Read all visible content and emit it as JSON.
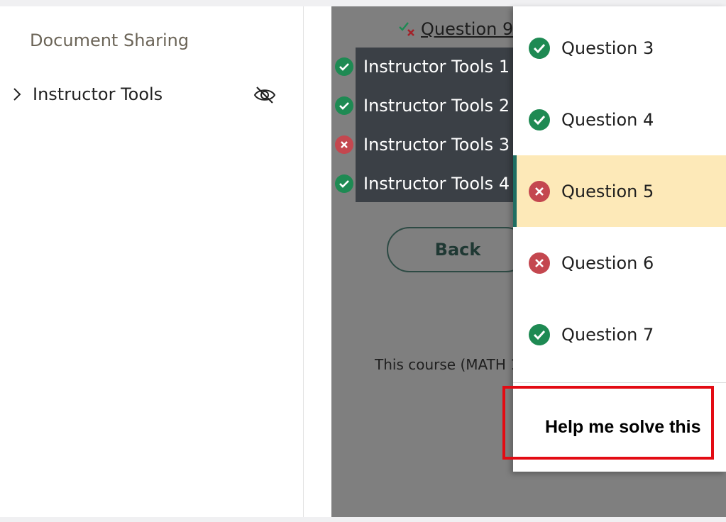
{
  "sidebar": {
    "heading": "Document Sharing",
    "items": [
      {
        "label": "Instructor Tools",
        "icon": "eye-slash-icon"
      }
    ]
  },
  "main": {
    "question_link": "Question 9",
    "tools": [
      {
        "label": "Instructor Tools 1",
        "status": "correct"
      },
      {
        "label": "Instructor Tools 2",
        "status": "correct"
      },
      {
        "label": "Instructor Tools 3",
        "status": "incorrect"
      },
      {
        "label": "Instructor Tools 4",
        "status": "correct"
      }
    ],
    "back_label": "Back",
    "course_text": "This course (MATH 1"
  },
  "question_panel": {
    "items": [
      {
        "label": "Question 3",
        "status": "correct",
        "active": false
      },
      {
        "label": "Question 4",
        "status": "correct",
        "active": false
      },
      {
        "label": "Question 5",
        "status": "incorrect",
        "active": true
      },
      {
        "label": "Question 6",
        "status": "incorrect",
        "active": false
      },
      {
        "label": "Question 7",
        "status": "correct",
        "active": false
      }
    ],
    "help_label": "Help me solve this"
  },
  "colors": {
    "correct": "#1e8a53",
    "incorrect": "#c4474f",
    "highlight": "#fde9b8",
    "annotation": "#e30b13"
  }
}
